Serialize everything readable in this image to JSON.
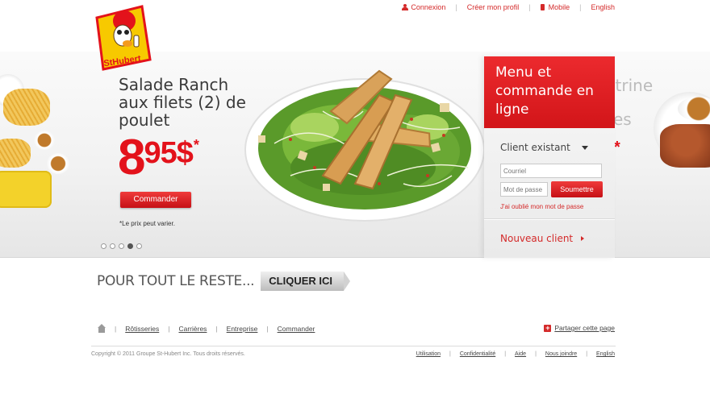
{
  "topnav": {
    "connexion": "Connexion",
    "profile": "Créer mon profil",
    "mobile": "Mobile",
    "english": "English",
    "separator": "|"
  },
  "logo": {
    "text": "StHubert"
  },
  "promo": {
    "title": "Salade Ranch aux filets (2) de poulet",
    "price_main": "8",
    "price_cents": "95$",
    "price_star": "*",
    "order_button": "Commander",
    "note": "*Le prix peut varier.",
    "slides": 5,
    "active_slide": 4
  },
  "background_words": {
    "word1": "itrine",
    "word2": "es",
    "star": "*"
  },
  "login": {
    "heading": "Menu et commande en ligne",
    "client_existing": "Client existant",
    "email_placeholder": "Courriel",
    "password_placeholder": "Mot de passe",
    "submit": "Soumettre",
    "forgot": "J'ai oublié mon mot de passe",
    "new_client": "Nouveau client"
  },
  "rest": {
    "text": "POUR TOUT LE RESTE...",
    "button": "CLIQUER ICI"
  },
  "footer": {
    "nav": [
      "Rôtisseries",
      "Carrières",
      "Entreprise",
      "Commander"
    ],
    "share": "Partager cette page",
    "copyright": "Copyright © 2011 Groupe St-Hubert Inc. Tous droits réservés.",
    "legal": [
      "Utilisation",
      "Confidentialité",
      "Aide",
      "Nous joindre",
      "English"
    ],
    "separator": "|"
  },
  "colors": {
    "brand_red": "#e3121b",
    "panel_red": "#d21519",
    "logo_yellow": "#f7c900"
  }
}
